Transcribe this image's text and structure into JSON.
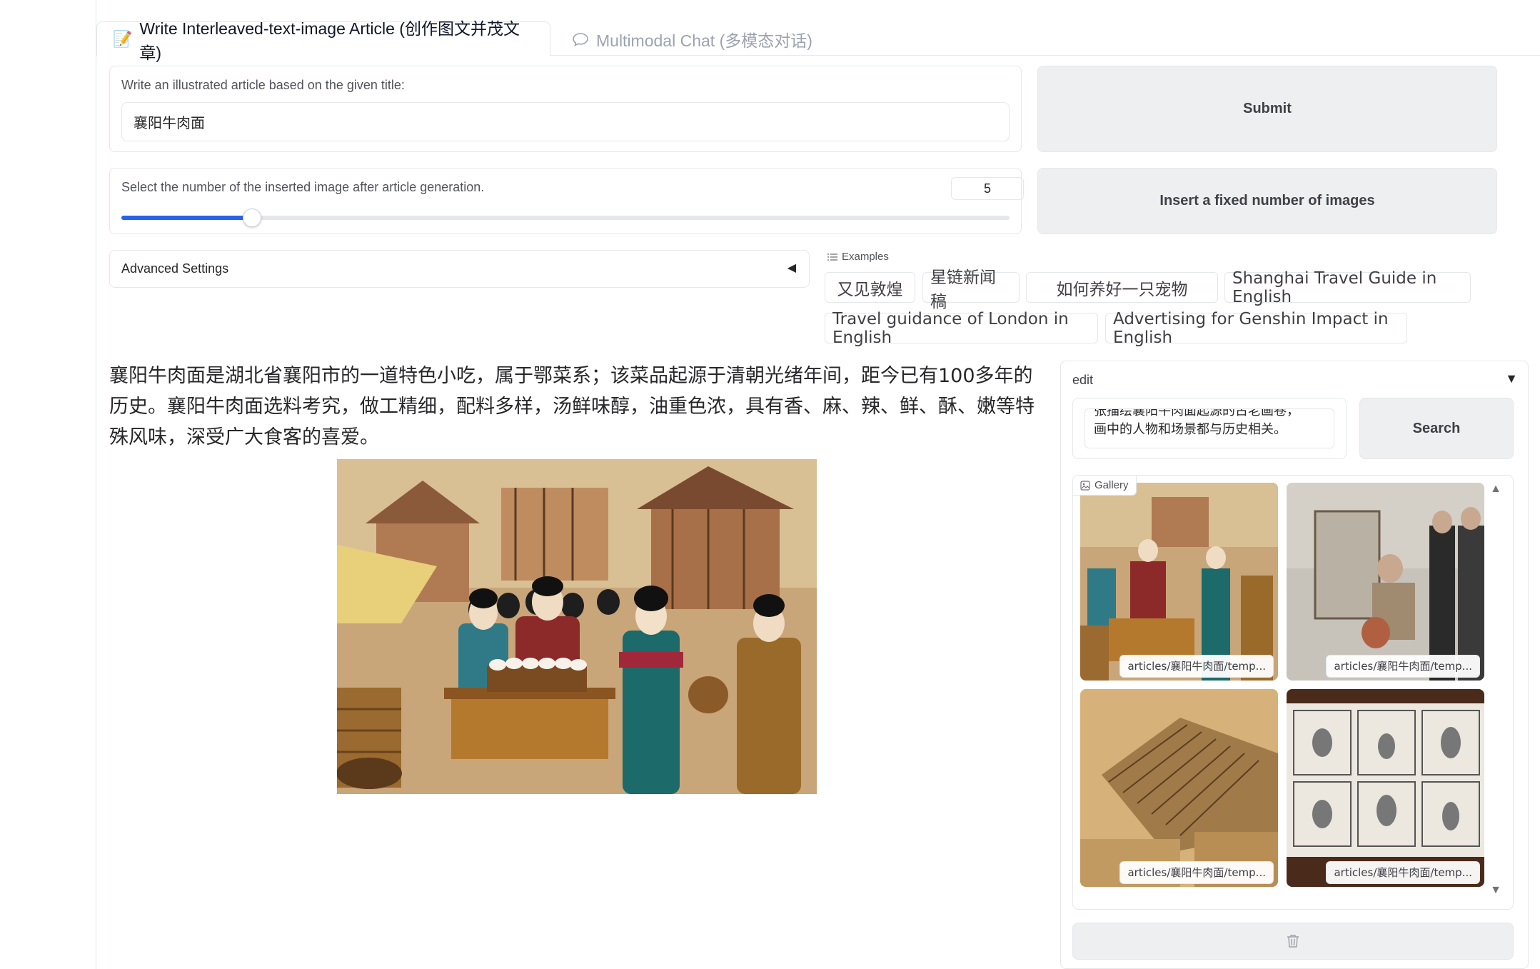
{
  "tabs": [
    {
      "label": "Write Interleaved-text-image Article (创作图文并茂文章)",
      "icon": "pencil-memo-icon",
      "active": true
    },
    {
      "label": "Multimodal Chat (多模态对话)",
      "icon": "chat-bubble-icon",
      "active": false
    }
  ],
  "title_input": {
    "label": "Write an illustrated article based on the given title:",
    "value": "襄阳牛肉面"
  },
  "slider": {
    "label": "Select the number of the inserted image after article generation.",
    "value": "5",
    "fill_fraction": 0.147
  },
  "buttons": {
    "submit": "Submit",
    "insert_fixed": "Insert a fixed number of images",
    "search": "Search"
  },
  "advanced": {
    "label": "Advanced Settings",
    "caret": "◀"
  },
  "examples": {
    "label": "Examples",
    "items": [
      "又见敦煌",
      "星链新闻稿",
      "如何养好一只宠物",
      "Shanghai Travel Guide in English",
      "Travel guidance of London in English",
      "Advertising for Genshin Impact in English"
    ]
  },
  "article": {
    "paragraph": "襄阳牛肉面是湖北省襄阳市的一道特色小吃，属于鄂菜系；该菜品起源于清朝光绪年间，距今已有100多年的历史。襄阳牛肉面选料考究，做工精细，配料多样，汤鲜味醇，油重色浓，具有香、麻、辣、鲜、酥、嫩等特殊风味，深受广大食客的喜爱。"
  },
  "edit_panel": {
    "label": "edit",
    "caret": "▼",
    "text_line1": "张描绘襄阳牛肉面起源的古老画卷，",
    "text_line2": "画中的人物和场景都与历史相关。"
  },
  "gallery": {
    "label": "Gallery",
    "captions": [
      "articles/襄阳牛肉面/temp...",
      "articles/襄阳牛肉面/temp...",
      "articles/襄阳牛肉面/temp...",
      "articles/襄阳牛肉面/temp..."
    ]
  },
  "colors": {
    "accent": "#2563eb",
    "button_bg": "#eeeff1",
    "border": "#e5e7eb"
  }
}
